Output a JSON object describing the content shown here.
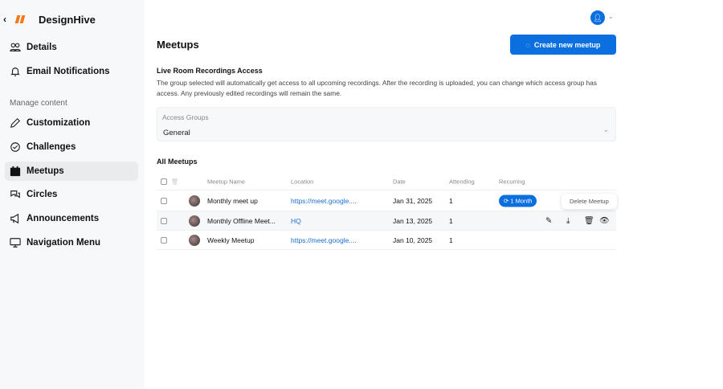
{
  "brand": {
    "name": "DesignHive",
    "back": "‹"
  },
  "sidebar": {
    "items": [
      {
        "label": "Details",
        "icon": "users-icon"
      },
      {
        "label": "Email Notifications",
        "icon": "bell-icon"
      }
    ],
    "section": "Manage content",
    "content_items": [
      {
        "label": "Customization"
      },
      {
        "label": "Challenges"
      },
      {
        "label": "Meetups",
        "active": true
      },
      {
        "label": "Circles"
      },
      {
        "label": "Announcements"
      },
      {
        "label": "Navigation Menu"
      }
    ]
  },
  "header": {
    "title": "Meetups",
    "create": "Create new meetup"
  },
  "recordings": {
    "title": "Live Room Recordings Access",
    "description": "The group selected will automatically get access to all upcoming recordings. After the recording is uploaded, you can change which access group has access. Any previously edited recordings will remain the same.",
    "label": "Access Groups",
    "value": "General"
  },
  "meetups": {
    "title": "All Meetups",
    "columns": [
      "Meetup Name",
      "Location",
      "Date",
      "Attending",
      "Recurring"
    ],
    "rows": [
      {
        "name": "Monthly meet up",
        "location": "https://meet.google....",
        "date": "Jan 31, 2025",
        "attending": "1",
        "recurring": "1 Month"
      },
      {
        "name": "Monthly Offline Meet...",
        "location": "HQ",
        "date": "Jan 13, 2025",
        "attending": "1",
        "recurring": ""
      },
      {
        "name": "Weekly Meetup",
        "location": "https://meet.google....",
        "date": "Jan 10, 2025",
        "attending": "1",
        "recurring": ""
      }
    ],
    "tooltip": "Delete Meetup"
  },
  "colors": {
    "accent": "#0b6fe0",
    "brand": "#f27a1a"
  }
}
